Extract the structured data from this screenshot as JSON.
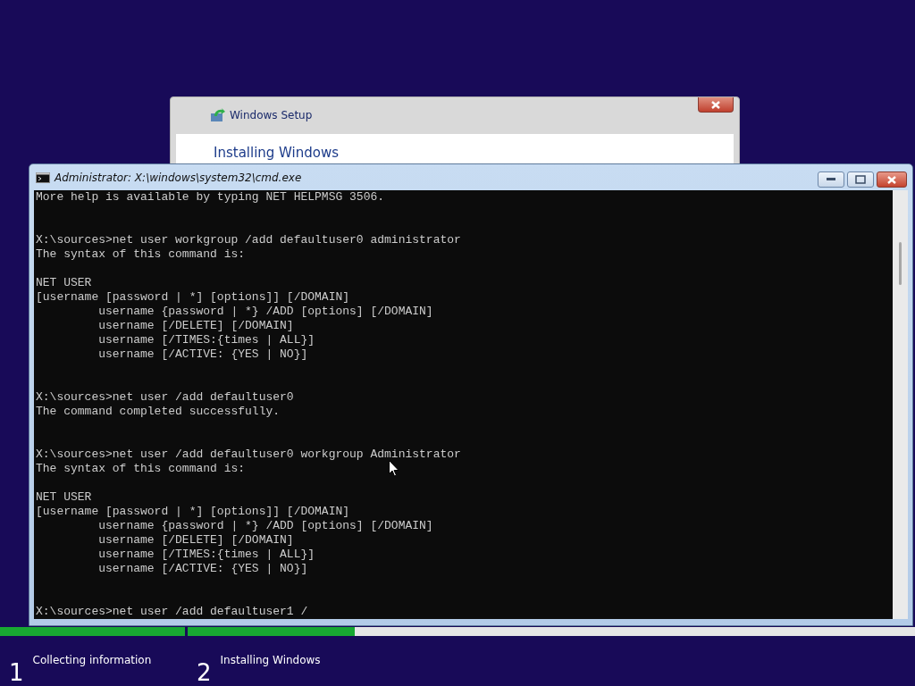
{
  "setup_window": {
    "title": "Windows Setup",
    "heading": "Installing Windows"
  },
  "cmd_window": {
    "title": "Administrator: X:\\windows\\system32\\cmd.exe",
    "sections": [
      [
        [
          "More help is available by typing NET HELPMSG 3506."
        ]
      ],
      [
        [
          "X:\\sources>net user workgroup /add defaultuser0 administrator",
          "The syntax of this command is:"
        ],
        [
          "NET USER",
          "[username [password | *] [options]] [/DOMAIN]",
          "         username {password | *} /ADD [options] [/DOMAIN]",
          "         username [/DELETE] [/DOMAIN]",
          "         username [/TIMES:{times | ALL}]",
          "         username [/ACTIVE: {YES | NO}]"
        ]
      ],
      [
        [
          "X:\\sources>net user /add defaultuser0",
          "The command completed successfully."
        ]
      ],
      [
        [
          "X:\\sources>net user /add defaultuser0 workgroup Administrator",
          "The syntax of this command is:"
        ],
        [
          "NET USER",
          "[username [password | *] [options]] [/DOMAIN]",
          "         username {password | *} /ADD [options] [/DOMAIN]",
          "         username [/DELETE] [/DOMAIN]",
          "         username [/TIMES:{times | ALL}]",
          "         username [/ACTIVE: {YES | NO}]"
        ]
      ],
      [
        [
          "X:\\sources>net user /add defaultuser1 /"
        ]
      ]
    ]
  },
  "steps": [
    {
      "number": "1",
      "label": "Collecting information",
      "level": 1
    },
    {
      "number": "2",
      "label": "Installing Windows",
      "level": 0.23
    }
  ]
}
